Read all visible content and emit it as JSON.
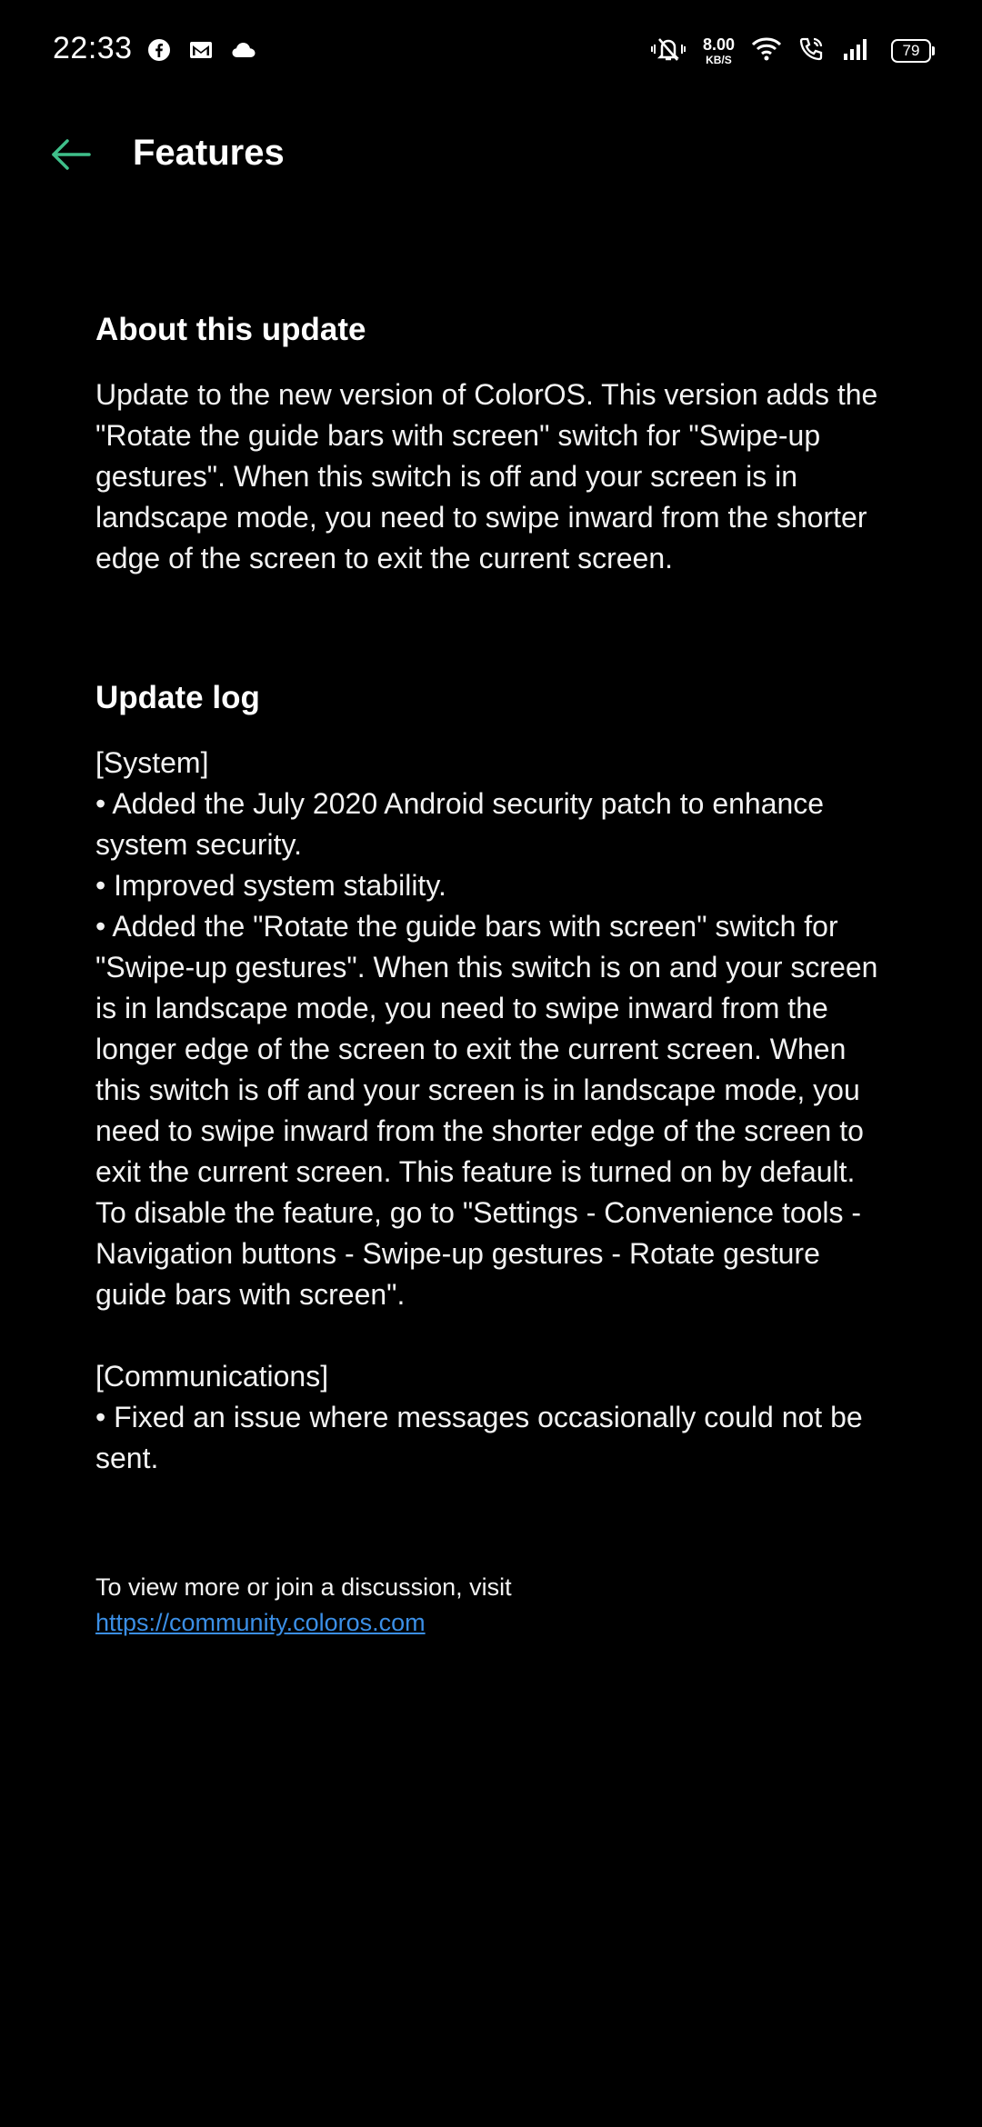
{
  "status_bar": {
    "time": "22:33",
    "net_speed_value": "8.00",
    "net_speed_unit": "KB/S",
    "battery": "79",
    "left_icons": [
      "facebook-icon",
      "gmail-icon",
      "cloud-icon"
    ],
    "right_icons": [
      "mute-vibrate-icon",
      "wifi-icon",
      "wifi-calling-icon",
      "signal-icon",
      "battery-icon"
    ]
  },
  "header": {
    "title": "Features",
    "back_icon": "back-arrow-icon",
    "accent_color": "#3fbf8a"
  },
  "about": {
    "heading": "About this update",
    "lines": [
      "Update to the new version of ColorOS. This version adds the",
      "\"Rotate the guide bars with screen\" switch for \"Swipe-up",
      "gestures\". When this switch is off and your screen is in",
      "landscape mode, you need to swipe inward from the shorter",
      "edge of the screen to exit the current screen."
    ]
  },
  "update_log": {
    "heading": "Update log",
    "system_lines": [
      "[System]",
      "• Added the July 2020 Android security patch to enhance",
      "system security.",
      "• Improved system stability.",
      "• Added the \"Rotate the guide bars with screen\" switch for",
      "\"Swipe-up gestures\". When this switch is on and your screen",
      "is in landscape mode, you need to swipe inward from the",
      "longer edge of the screen to exit the current screen. When",
      "this switch is off and your screen is in landscape mode, you",
      "need to swipe inward from the shorter edge of the screen to",
      "exit the current screen. This feature is turned on by default.",
      "To disable the feature, go to \"Settings - Convenience tools -",
      "Navigation buttons - Swipe-up gestures - Rotate gesture",
      "guide bars with screen\"."
    ],
    "communications_lines": [
      "[Communications]",
      "• Fixed an issue where messages occasionally could not be",
      "sent."
    ]
  },
  "footer": {
    "note": "To view more or join a discussion, visit",
    "link_text": "https://community.coloros.com",
    "link_color": "#3b8fe6"
  }
}
